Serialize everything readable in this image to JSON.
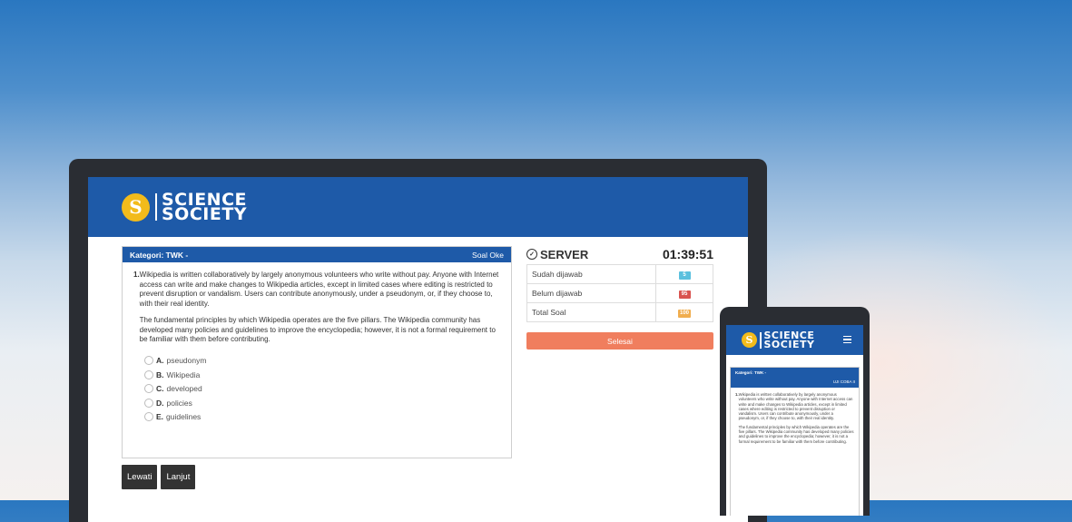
{
  "brand": {
    "line1": "SCIENCE",
    "line2": "SOCIETY",
    "mark": "S"
  },
  "question_panel": {
    "category": "Kategori: TWK -",
    "title_right": "Soal Oke",
    "number": "1.",
    "paragraphs": [
      "Wikipedia is written collaboratively by largely anonymous volunteers who write without pay. Anyone with Internet access can write and make changes to Wikipedia articles, except in limited cases where editing is restricted to prevent disruption or vandalism. Users can contribute anonymously, under a pseudonym, or, if they choose to, with their real identity.",
      "The fundamental principles by which Wikipedia operates are the five pillars. The Wikipedia community has developed many policies and guidelines to improve the encyclopedia; however, it is not a formal requirement to be familiar with them before contributing."
    ],
    "options": [
      {
        "letter": "A.",
        "text": "pseudonym"
      },
      {
        "letter": "B.",
        "text": "Wikipedia"
      },
      {
        "letter": "C.",
        "text": "developed"
      },
      {
        "letter": "D.",
        "text": "policies"
      },
      {
        "letter": "E.",
        "text": "guidelines"
      }
    ]
  },
  "buttons": {
    "skip": "Lewati",
    "next": "Lanjut"
  },
  "sidebar": {
    "server_label": "SERVER",
    "timer": "01:39:51",
    "stats": [
      {
        "label": "Sudah dijawab",
        "value": "5",
        "color": "#5bc0de"
      },
      {
        "label": "Belum dijawab",
        "value": "95",
        "color": "#d9534f"
      },
      {
        "label": "Total Soal",
        "value": "100",
        "color": "#f0ad4e"
      }
    ],
    "finish_label": "Selesai"
  },
  "mobile": {
    "category": "Kategori: TWK -",
    "title_right": "UJI COBA II",
    "number": "1.",
    "paragraphs": [
      "Wikipedia is written collaboratively by largely anonymous volunteers who write without pay. Anyone with Internet access can write and make changes to Wikipedia articles, except in limited cases where editing is restricted to prevent disruption or vandalism. Users can contribute anonymously, under a pseudonym, or, if they choose to, with their real identity.",
      "The fundamental principles by which Wikipedia operates are the five pillars. The Wikipedia community has developed many policies and guidelines to improve the encyclopedia; however, it is not a formal requirement to be familiar with them before contributing."
    ]
  },
  "colors": {
    "primary": "#1e5aa8",
    "accent": "#f2bb1b",
    "finish": "#f07e5e"
  }
}
